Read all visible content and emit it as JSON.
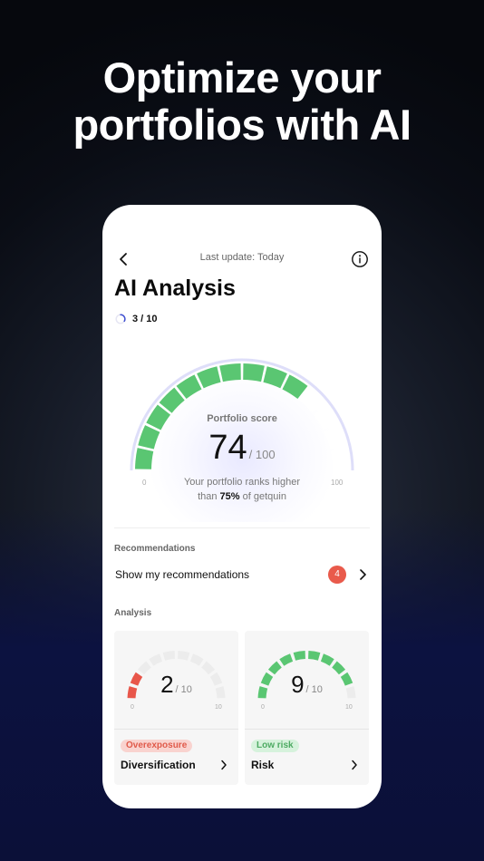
{
  "headline": {
    "line1": "Optimize your",
    "line2": "portfolios with AI"
  },
  "header": {
    "last_update": "Last update: Today"
  },
  "page": {
    "title": "AI Analysis",
    "progress": "3 / 10"
  },
  "portfolio_score": {
    "label": "Portfolio score",
    "value": "74",
    "max": "/ 100",
    "axis_min": "0",
    "axis_max": "100",
    "rank_pre": "Your portfolio ranks higher",
    "rank_line2_pre": "than ",
    "rank_percent": "75%",
    "rank_line2_post": " of getquin",
    "fill_fraction": 0.74,
    "segments": 14
  },
  "recommendations": {
    "section_label": "Recommendations",
    "row_text": "Show my recommendations",
    "badge": "4"
  },
  "analysis": {
    "section_label": "Analysis",
    "cards": [
      {
        "value": "2",
        "max": "/ 10",
        "axis_min": "0",
        "axis_max": "10",
        "tag": "Overexposure",
        "title": "Diversification",
        "filled": 2,
        "segments": 10,
        "color": "#e8564a"
      },
      {
        "value": "9",
        "max": "/ 10",
        "axis_min": "0",
        "axis_max": "10",
        "tag": "Low risk",
        "title": "Risk",
        "filled": 9,
        "segments": 10,
        "color": "#5ac672"
      }
    ]
  },
  "colors": {
    "green": "#5ac672",
    "red": "#e8564a",
    "empty_segment": "#ececec",
    "badge": "#e95a4b"
  }
}
